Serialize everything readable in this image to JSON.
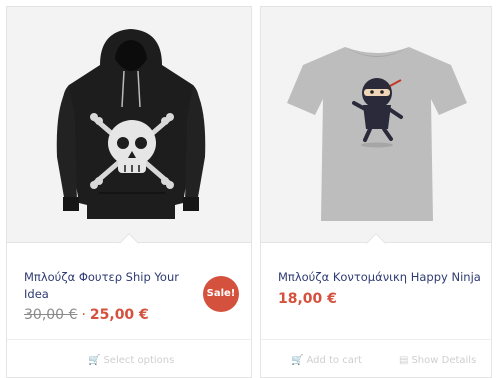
{
  "colors": {
    "sale_badge": "#d4513d",
    "price": "#d4513d",
    "title": "#2f3b73",
    "image_bg": "#f3f3f3",
    "action_text": "#cfcfcf"
  },
  "products": [
    {
      "title": "Μπλούζα Φουτερ Ship Your Idea",
      "old_price": "30,00 €",
      "separator": "·",
      "price": "25,00 €",
      "sale_badge": "Sale!",
      "image_icon": "black-hoodie-skull-image",
      "actions": [
        {
          "icon": "cart-icon",
          "label": "Select options"
        }
      ]
    },
    {
      "title": "Μπλούζα Κοντομάνικη Happy Ninja",
      "price": "18,00 €",
      "image_icon": "grey-tshirt-ninja-image",
      "actions": [
        {
          "icon": "cart-icon",
          "label": "Add to cart"
        },
        {
          "icon": "details-icon",
          "label": "Show Details"
        }
      ]
    }
  ]
}
